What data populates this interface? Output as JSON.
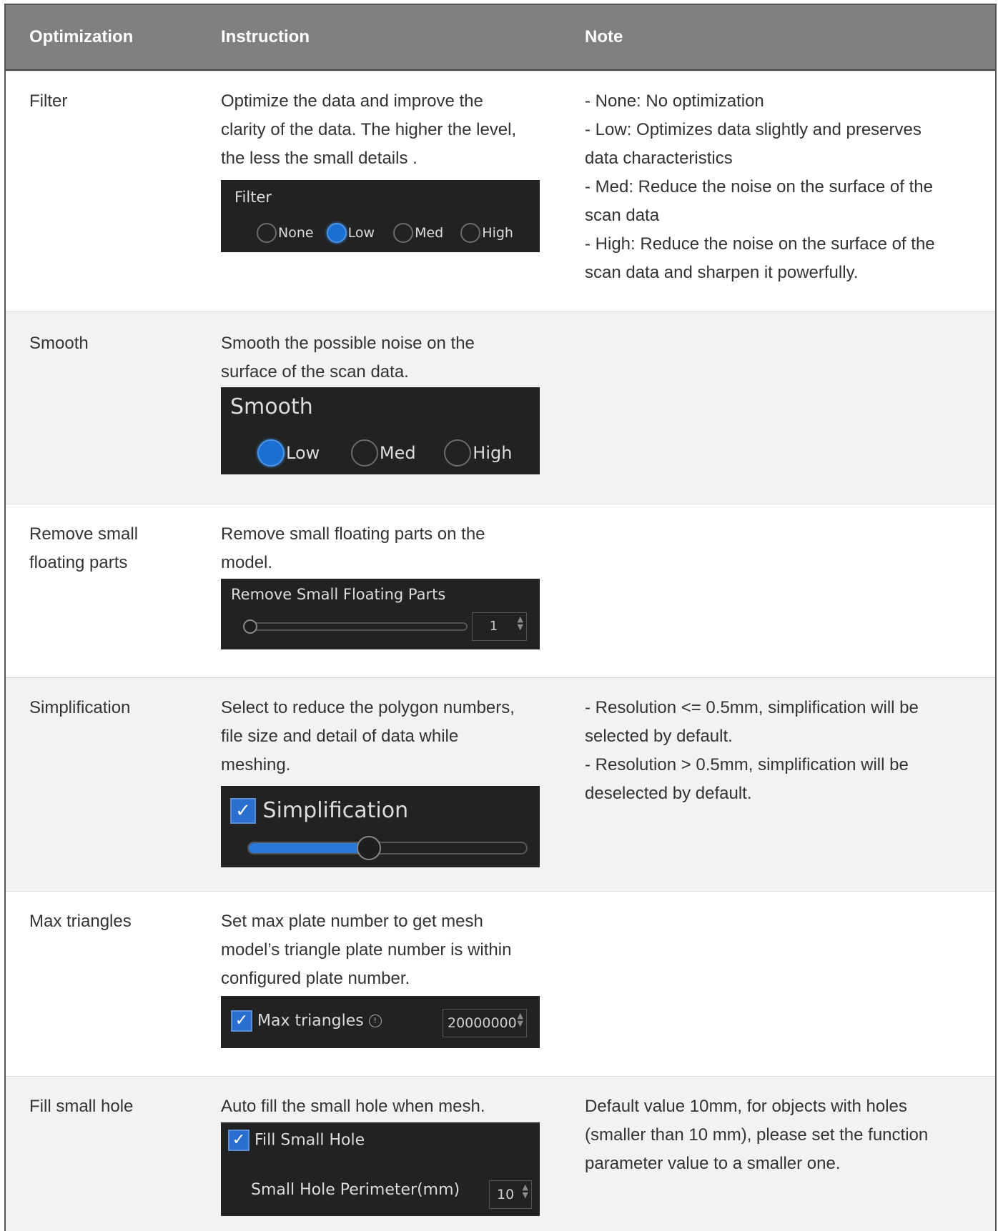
{
  "header": {
    "col1": "Optimization",
    "col2": "Instruction",
    "col3": "Note"
  },
  "colors": {
    "header_bg": "#808080",
    "panel_bg": "#222222",
    "accent": "#1a6fd1"
  },
  "rows": [
    {
      "name": "Filter",
      "instruction": [
        "Optimize the data and improve the",
        "clarity of the data. The higher the level,",
        "the less the small details ."
      ],
      "notes": [
        "- None: No optimization",
        "- Low: Optimizes data slightly and preserves",
        "data characteristics",
        "- Med: Reduce the noise on the surface of the",
        "scan data",
        "- High: Reduce the noise on the surface of the",
        "scan data and sharpen it powerfully."
      ],
      "panel": {
        "title": "Filter",
        "options": [
          "None",
          "Low",
          "Med",
          "High"
        ],
        "selected": "Low"
      }
    },
    {
      "name": "Smooth",
      "instruction": [
        "Smooth the possible noise on the",
        "surface of the scan data."
      ],
      "notes": [],
      "panel": {
        "title": "Smooth",
        "options": [
          "Low",
          "Med",
          "High"
        ],
        "selected": "Low"
      }
    },
    {
      "name_lines": [
        "Remove small",
        "floating parts"
      ],
      "instruction": [
        "Remove small floating parts on the",
        "model."
      ],
      "notes": [],
      "panel": {
        "title": "Remove Small Floating Parts",
        "value": "1",
        "slider_level": 0.0
      }
    },
    {
      "name": "Simplification",
      "instruction": [
        "Select to reduce the polygon numbers,",
        "file size and detail of data while",
        "meshing."
      ],
      "notes": [
        "- Resolution <= 0.5mm, simplification will be",
        "selected by default.",
        "- Resolution > 0.5mm, simplification will be",
        "deselected by default."
      ],
      "panel": {
        "title": "Simplification",
        "checked": true,
        "slider_level": 0.4
      }
    },
    {
      "name": "Max triangles",
      "instruction": [
        "Set max plate number to get mesh",
        "model’s triangle plate number is within",
        "configured plate number."
      ],
      "notes": [],
      "panel": {
        "title": "Max triangles",
        "checked": true,
        "value": "20000000"
      }
    },
    {
      "name": "Fill small hole",
      "instruction": [
        "Auto fill the small hole when mesh."
      ],
      "notes": [
        "Default value 10mm, for objects with holes",
        "(smaller than 10 mm), please set the function",
        "parameter value to a smaller one."
      ],
      "panel": {
        "title": "Fill Small Hole",
        "checked": true,
        "sub_label": "Small Hole Perimeter(mm)",
        "value": "10"
      }
    }
  ]
}
